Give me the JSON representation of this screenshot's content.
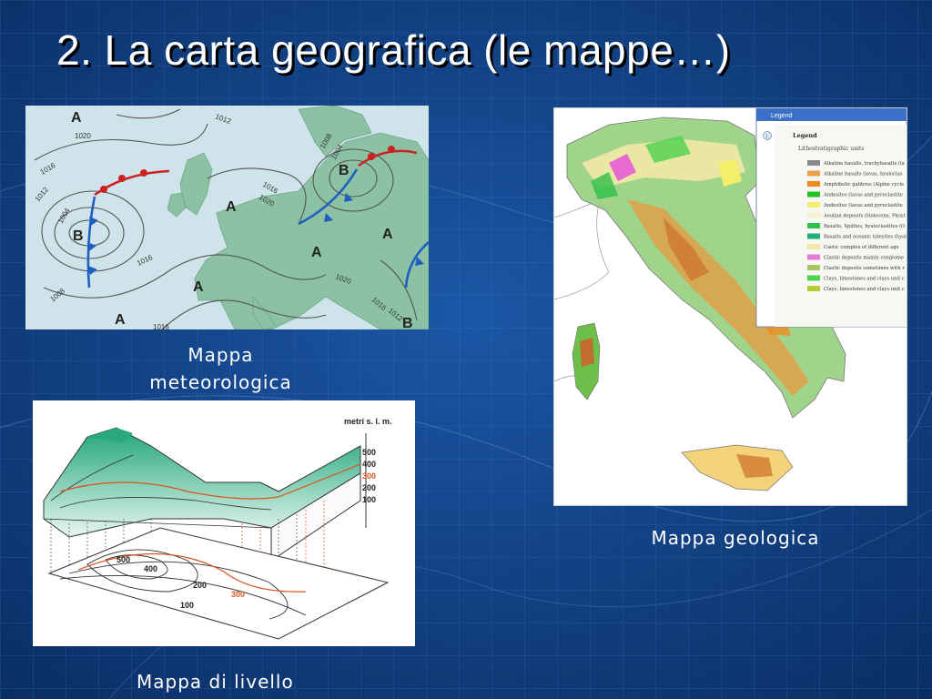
{
  "slide": {
    "title": "2. La carta geografica (le mappe…)",
    "background_color": "#0e3a78"
  },
  "weather_map": {
    "caption": "Mappa meteorologica",
    "caption_line1": "Mappa",
    "caption_line2": "meteorologica",
    "pressure_labels": [
      "A",
      "B",
      "A",
      "A",
      "B",
      "A",
      "A",
      "A",
      "B",
      "A"
    ],
    "isobar_labels": [
      "1012",
      "1020",
      "1016",
      "1012",
      "1004",
      "1008",
      "1004",
      "1008",
      "1016",
      "1020",
      "1016",
      "1020",
      "1016",
      "1012",
      "1016"
    ],
    "colors": {
      "sea": "#cfe4ea",
      "land": "#8cc2a3",
      "warm_front": "#cc2222",
      "cold_front": "#1f5fbf"
    }
  },
  "relief_map": {
    "caption": "Mappa di livello",
    "axis_title": "metri s. l. m.",
    "scale_labels": [
      "500",
      "400",
      "300",
      "200",
      "100"
    ],
    "contour_labels": [
      "500",
      "400",
      "200",
      "300",
      "100"
    ],
    "highlight_color": "#d9541e"
  },
  "geo_map": {
    "caption": "Mappa geologica",
    "window_title": "Legend",
    "legend_title": "Legend",
    "legend_subtitle": "Lithostratigraphic units",
    "legend_items": [
      {
        "label": "Alkaline basalts, trachybasalts (la",
        "color": "#8a8a8a"
      },
      {
        "label": "Alkaline basalts (lavas, hyaloclas",
        "color": "#e8a04a"
      },
      {
        "label": "Amphibolic gabbros (Alpine cycle",
        "color": "#f08a1f"
      },
      {
        "label": "Andesites (lavas and pyroclastite",
        "color": "#22c422"
      },
      {
        "label": "Andesites (lavas and pyroclastite",
        "color": "#f4ef6a"
      },
      {
        "label": "Aeolian deposits (Holocene, Pleist",
        "color": "#f7f3d0"
      },
      {
        "label": "Basalts, Spilites, hyaloclastites (O",
        "color": "#2fbf4a"
      },
      {
        "label": "Basalts and oceanic toleyites (hyal",
        "color": "#1fb07a"
      },
      {
        "label": "Caotic complex of different age",
        "color": "#f2e6a8"
      },
      {
        "label": "Clastic deposits mainly conglome",
        "color": "#e67ad8"
      },
      {
        "label": "Clastic deposits sometimes with r",
        "color": "#a8c466"
      },
      {
        "label": "Clays, limestones and clays unit c",
        "color": "#4cd24c"
      },
      {
        "label": "Clays, limestones and clays unit c",
        "color": "#b6c832"
      }
    ]
  }
}
